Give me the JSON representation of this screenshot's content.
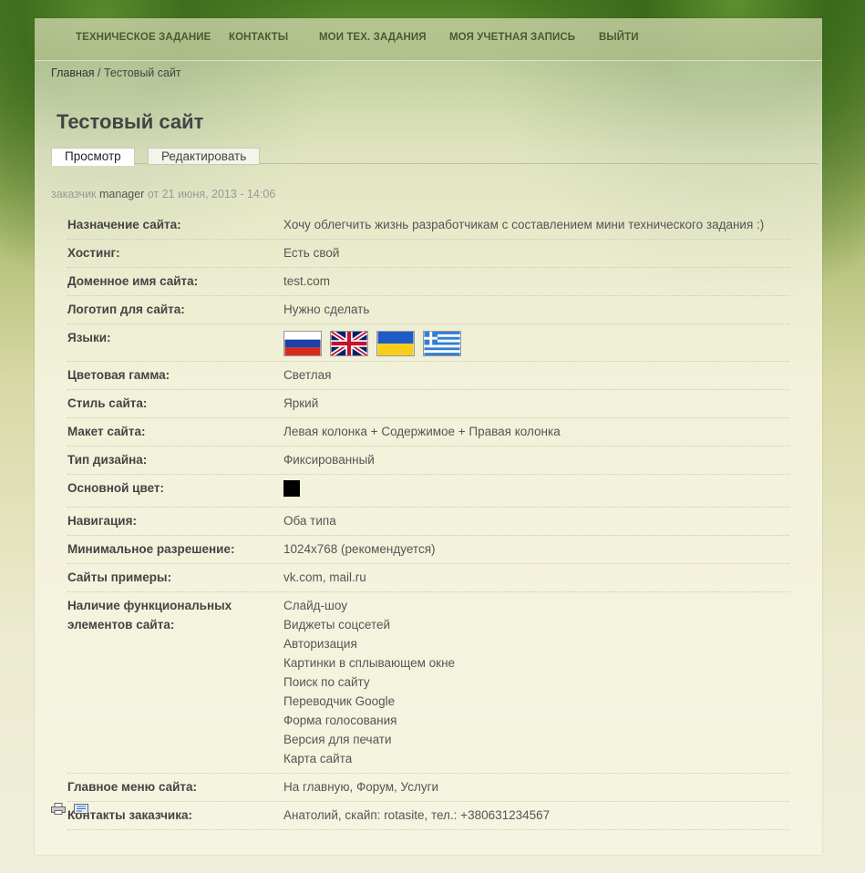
{
  "nav": [
    {
      "label": "ТЕХНИЧЕСКОЕ ЗАДАНИЕ"
    },
    {
      "label": "КОНТАКТЫ"
    },
    {
      "label": "МОИ ТЕХ. ЗАДАНИЯ"
    },
    {
      "label": "МОЯ УЧЕТНАЯ ЗАПИСЬ"
    },
    {
      "label": "ВЫЙТИ"
    }
  ],
  "breadcrumb": {
    "home": "Главная",
    "separator": " / ",
    "current": "Тестовый сайт"
  },
  "page_title": "Тестовый сайт",
  "tabs": [
    {
      "label": "Просмотр",
      "active": true
    },
    {
      "label": "Редактировать",
      "active": false
    }
  ],
  "meta": {
    "prefix": "заказчик ",
    "author": "manager",
    "date": " от 21 июня, 2013 - 14:06"
  },
  "fields": [
    {
      "label": "Назначение сайта:",
      "value": "Хочу облегчить жизнь разработчикам с составлением мини технического задания :)"
    },
    {
      "label": "Хостинг:",
      "value": "Есть свой"
    },
    {
      "label": "Доменное имя сайта:",
      "value": "test.com"
    },
    {
      "label": "Логотип для сайта:",
      "value": "Нужно сделать"
    },
    {
      "label": "Языки:",
      "flags": [
        "russia-flag-icon",
        "uk-flag-icon",
        "ukraine-flag-icon",
        "greece-flag-icon"
      ]
    },
    {
      "label": "Цветовая гамма:",
      "value": "Светлая"
    },
    {
      "label": "Стиль сайта:",
      "value": "Яркий"
    },
    {
      "label": "Макет сайта:",
      "value": "Левая колонка + Содержимое + Правая колонка"
    },
    {
      "label": "Тип дизайна:",
      "value": "Фиксированный"
    },
    {
      "label": "Основной цвет:",
      "color": "#000000"
    },
    {
      "label": "Навигация:",
      "value": "Оба типа"
    },
    {
      "label": "Минимальное разрешение:",
      "value": "1024x768 (рекомендуется)"
    },
    {
      "label": "Сайты примеры:",
      "value": "vk.com, mail.ru"
    },
    {
      "label": "Наличие функциональных элементов сайта:",
      "list": [
        "Слайд-шоу",
        "Виджеты соцсетей",
        "Авторизация",
        "Картинки в сплывающем окне",
        "Поиск по сайту",
        "Переводчик Google",
        "Форма голосования",
        "Версия для печати",
        "Карта сайта"
      ]
    },
    {
      "label": "Главное меню сайта:",
      "value": "На главную, Форум, Услуги"
    },
    {
      "label": "Контакты заказчика:",
      "value": "Анатолий, скайп: rotasite, тел.: +380631234567"
    }
  ],
  "footer_icons": [
    "printer-icon",
    "email-icon"
  ]
}
